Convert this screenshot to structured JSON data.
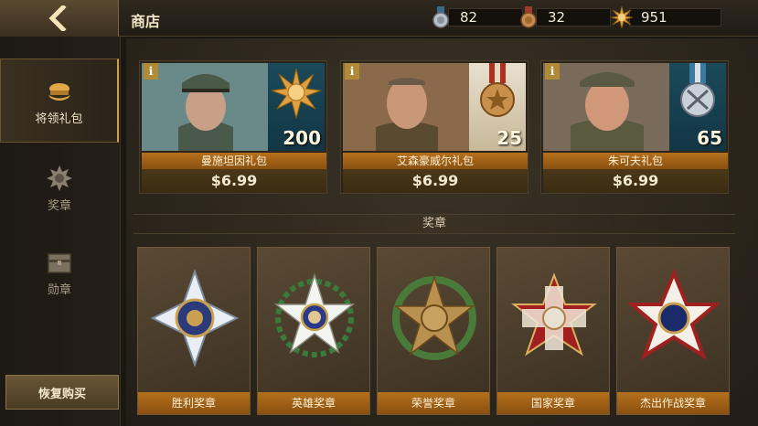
{
  "header": {
    "title": "商店",
    "resources": [
      {
        "icon": "silver-medal-icon",
        "value": "82"
      },
      {
        "icon": "bronze-medal-icon",
        "value": "32"
      },
      {
        "icon": "gold-star-icon",
        "value": "951"
      }
    ]
  },
  "sidebar": {
    "items": [
      {
        "label": "将领礼包",
        "icon": "officer-cap-icon",
        "active": true
      },
      {
        "label": "奖章",
        "icon": "medal-gear-icon",
        "active": false
      },
      {
        "label": "勋章",
        "icon": "chest-icon",
        "active": false
      }
    ],
    "restore_label": "恢复购买"
  },
  "packs": [
    {
      "name": "曼施坦因礼包",
      "price": "$6.99",
      "count": "200",
      "medal_icon": "gold-star-medal-icon"
    },
    {
      "name": "艾森豪威尔礼包",
      "price": "$6.99",
      "count": "25",
      "medal_icon": "bronze-medal-icon"
    },
    {
      "name": "朱可夫礼包",
      "price": "$6.99",
      "count": "65",
      "medal_icon": "silver-medal-icon"
    }
  ],
  "info_label": "i",
  "section_title": "奖章",
  "medals": [
    {
      "name": "胜利奖章",
      "icon": "victory-medal-icon"
    },
    {
      "name": "英雄奖章",
      "icon": "hero-medal-icon"
    },
    {
      "name": "荣誉奖章",
      "icon": "honor-medal-icon"
    },
    {
      "name": "国家奖章",
      "icon": "national-medal-icon"
    },
    {
      "name": "杰出作战奖章",
      "icon": "distinguished-combat-medal-icon"
    }
  ]
}
